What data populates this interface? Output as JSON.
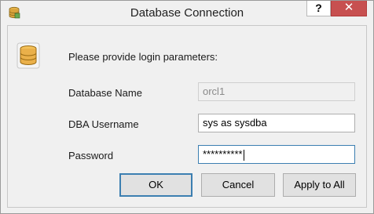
{
  "window": {
    "title": "Database Connection",
    "help_label": "?",
    "close_label": "✕"
  },
  "dialog": {
    "intro": "Please provide login parameters:",
    "fields": {
      "database_name": {
        "label": "Database Name",
        "value": "orcl1"
      },
      "dba_username": {
        "label": "DBA Username",
        "value": "sys as sysdba"
      },
      "password": {
        "label": "Password",
        "value": "**********"
      }
    }
  },
  "buttons": {
    "ok": "OK",
    "cancel": "Cancel",
    "apply_to_all": "Apply to All"
  },
  "icons": {
    "title": "database-icon",
    "dialog": "database-icon"
  }
}
